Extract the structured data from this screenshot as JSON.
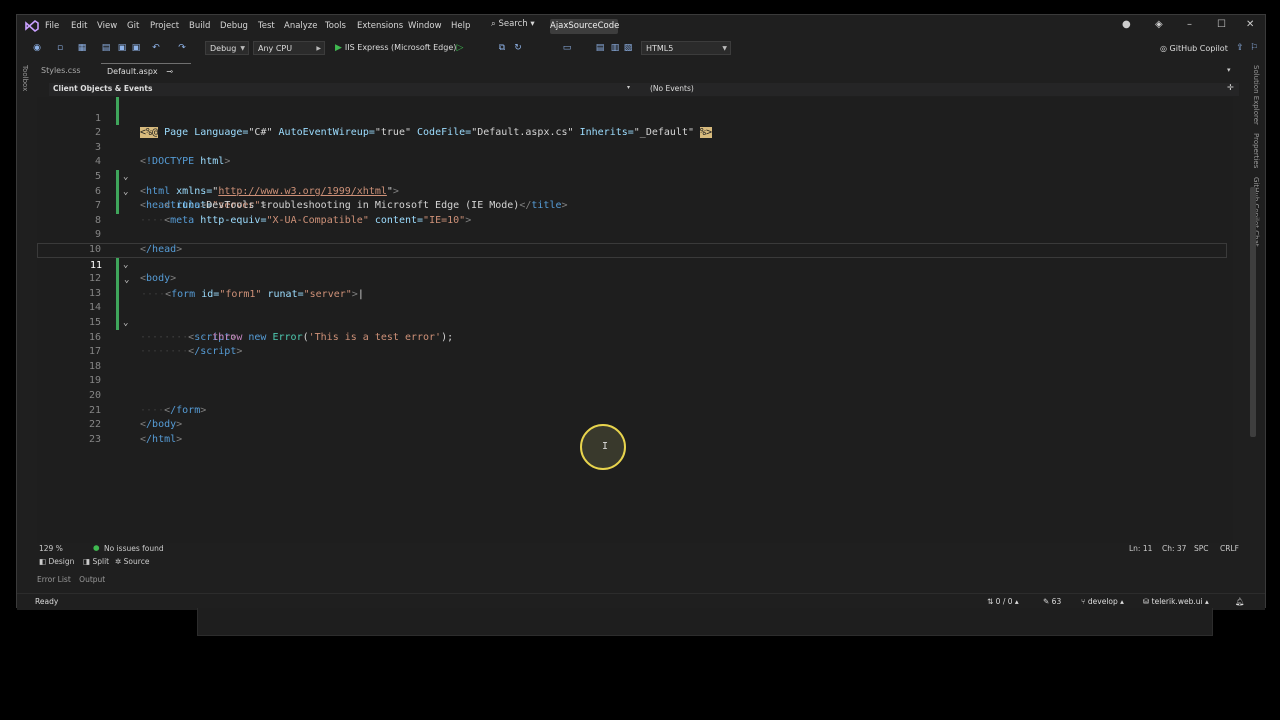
{
  "menu": [
    "File",
    "Edit",
    "View",
    "Git",
    "Project",
    "Build",
    "Debug",
    "Test",
    "Analyze",
    "Tools",
    "Extensions",
    "Window",
    "Help"
  ],
  "search_label": "Search",
  "solution_title": "AjaxSourceCode",
  "toolbar": {
    "config": "Debug",
    "platform": "Any CPU",
    "run_target": "IIS Express (Microsoft Edge)",
    "schema": "HTML5",
    "copilot": "GitHub Copilot"
  },
  "tabs": [
    {
      "label": "Styles.css",
      "active": false
    },
    {
      "label": "Default.aspx",
      "active": true
    }
  ],
  "side_left": "Toolbox",
  "side_right": [
    "Solution Explorer",
    "Properties",
    "GitHub Copilot Chat"
  ],
  "navbar": {
    "left": "Client Objects & Events",
    "right": "(No Events)"
  },
  "editor": {
    "current_line": 11,
    "lines": [
      "1",
      "2",
      "3",
      "4",
      "5",
      "6",
      "7",
      "8",
      "9",
      "10",
      "11",
      "12",
      "13",
      "14",
      "15",
      "16",
      "17",
      "18",
      "19",
      "20",
      "21",
      "22",
      "23"
    ],
    "code": {
      "l1_page": "Page",
      "l1_lang_attr": "Language=",
      "l1_lang_val": "\"C#\"",
      "l1_auto_attr": "AutoEventWireup=",
      "l1_auto_val": "\"true\"",
      "l1_cf_attr": "CodeFile=",
      "l1_cf_val": "\"Default.aspx.cs\"",
      "l1_inh_attr": "Inherits=",
      "l1_inh_val": "\"_Default\"",
      "l3_doctype": "!DOCTYPE",
      "l3_html": "html",
      "l4_tag": "html",
      "l4_attr": "xmlns=",
      "l4_url": "http://www.w3.org/1999/xhtml",
      "l5_tag": "head",
      "l5_attr": "runat=",
      "l5_val": "\"server\"",
      "l6_tag": "title",
      "l6_text": "DevTools troubleshooting in Microsoft Edge (IE Mode)",
      "l7_tag": "meta",
      "l7_attr1": "http-equiv=",
      "l7_val1": "\"X-UA-Compatible\"",
      "l7_attr2": "content=",
      "l7_val2": "\"IE=10\"",
      "l9_close": "/head",
      "l10_tag": "body",
      "l11_tag": "form",
      "l11_attr1": "id=",
      "l11_val1": "\"form1\"",
      "l11_attr2": "runat=",
      "l11_val2": "\"server\"",
      "l14_tag": "script",
      "l15_throw": "throw",
      "l15_new": "new",
      "l15_err": "Error",
      "l15_str": "'This is a test error'",
      "l16_close": "/script",
      "l20_close": "/form",
      "l21_close": "/body",
      "l22_close": "/html"
    }
  },
  "status": {
    "zoom": "129 %",
    "issues": "No issues found",
    "ln": "Ln: 11",
    "ch": "Ch: 37",
    "spc": "SPC",
    "crlf": "CRLF"
  },
  "views": [
    "Design",
    "Split",
    "Source"
  ],
  "panels": [
    "Error List",
    "Output"
  ],
  "statusbar": {
    "ready": "Ready",
    "changes": "0 / 0",
    "edits": "63",
    "branch": "develop",
    "repo": "telerik.web.ui"
  },
  "colors": {
    "accent": "#3fa55b",
    "tag": "#569cd6",
    "attr": "#9cdcfe",
    "string": "#ce9178",
    "directive": "#d7ba7d"
  }
}
